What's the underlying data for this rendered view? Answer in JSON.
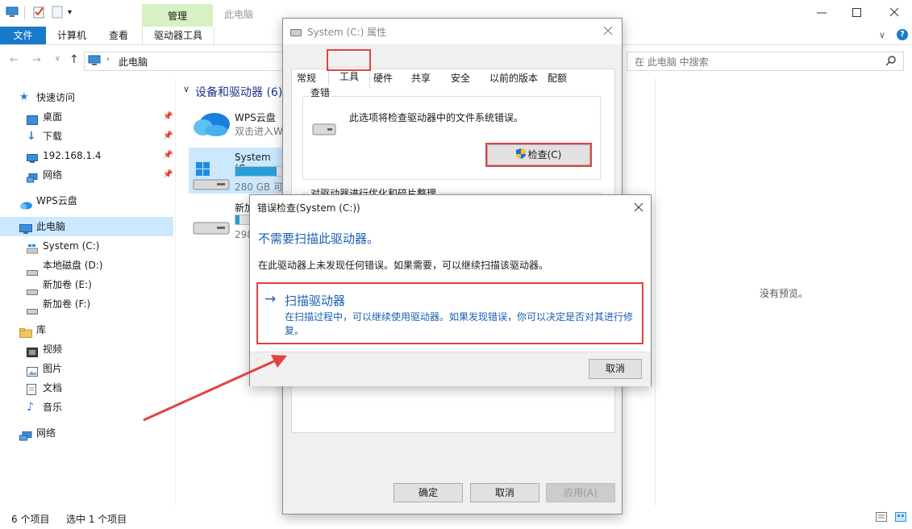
{
  "window": {
    "title": "此电脑",
    "context_tab": "管理",
    "ribbon_tabs": [
      "文件",
      "计算机",
      "查看",
      "驱动器工具"
    ],
    "breadcrumb": "此电脑",
    "search_placeholder": "在 此电脑 中搜索"
  },
  "nav": {
    "quick_access": "快速访问",
    "desktop": "桌面",
    "downloads": "下载",
    "ip": "192.168.1.4",
    "network_pinned": "网络",
    "wps": "WPS云盘",
    "this_pc": "此电脑",
    "system_c": "System (C:)",
    "local_d": "本地磁盘 (D:)",
    "new_e": "新加卷 (E:)",
    "new_f": "新加卷 (F:)",
    "library": "库",
    "video": "视频",
    "pictures": "图片",
    "documents": "文档",
    "music": "音乐",
    "network": "网络"
  },
  "content": {
    "group_header": "设备和驱动器 (6)",
    "wps_name": "WPS云盘",
    "wps_sub": "双击进入W",
    "system_name": "System (C:",
    "system_size": "280 GB 可",
    "system_used_fraction": 0.83,
    "new_name": "新加",
    "new_size": "298",
    "new_used_fraction": 0.08,
    "no_preview": "没有预览。"
  },
  "status": {
    "items": "6 个项目",
    "selected": "选中 1 个项目"
  },
  "props": {
    "title": "System (C:) 属性",
    "tabs": [
      "常规",
      "工具",
      "硬件",
      "共享",
      "安全",
      "以前的版本",
      "配额"
    ],
    "group_check": "查错",
    "check_desc": "此选项将检查驱动器中的文件系统错误。",
    "check_button": "检查(C)",
    "group_optimize": "对驱动器进行优化和碎片整理",
    "ok": "确定",
    "cancel": "取消",
    "apply": "应用(A)"
  },
  "errcheck": {
    "title": "错误检查(System (C:))",
    "heading": "不需要扫描此驱动器。",
    "desc": "在此驱动器上未发现任何错误。如果需要，可以继续扫描该驱动器。",
    "scan_title": "扫描驱动器",
    "scan_desc": "在扫描过程中，可以继续使用驱动器。如果发现错误，你可以决定是否对其进行修复。",
    "cancel": "取消"
  },
  "colors": {
    "accent": "#1979ca",
    "highlight_red": "#e04343",
    "ribbon_context": "#d7f0c4",
    "drive_bar": "#26a0da"
  }
}
